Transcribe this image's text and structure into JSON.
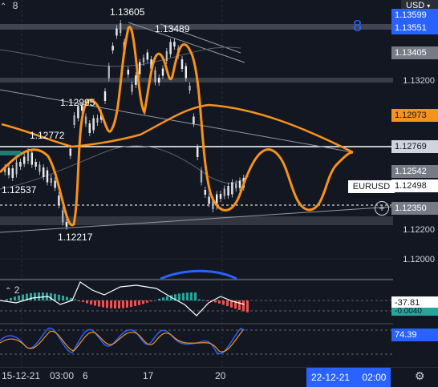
{
  "header": {
    "pane_number": "8",
    "currency": "USD"
  },
  "price_scale": {
    "ticks": [
      "1.13200",
      "1.12200",
      "1.12000"
    ],
    "tags": [
      {
        "label": "1.13599",
        "bg": "#2962ff",
        "fg": "#ffffff"
      },
      {
        "label": "1.13551",
        "bg": "#2962ff",
        "fg": "#ffffff"
      },
      {
        "label": "1.13405",
        "bg": "#787b86",
        "fg": "#ffffff"
      },
      {
        "label": "1.12973",
        "bg": "#f7931a",
        "fg": "#131722"
      },
      {
        "label": "1.12769",
        "bg": "#d1d4dc",
        "fg": "#131722"
      },
      {
        "label": "1.12542",
        "bg": "#787b86",
        "fg": "#ffffff"
      },
      {
        "label": "1.12498",
        "bg": "#ffffff",
        "fg": "#131722"
      },
      {
        "label": "1.12350",
        "bg": "#787b86",
        "fg": "#ffffff"
      }
    ]
  },
  "symbol_tag": "EURUSD",
  "annotations": [
    {
      "label": "1.13605"
    },
    {
      "label": "1.13489"
    },
    {
      "label": "1.12995"
    },
    {
      "label": "1.12772"
    },
    {
      "label": "1.12537"
    },
    {
      "label": "1.12217"
    }
  ],
  "indicators": {
    "macd_pane_number": "2",
    "macd_value": "-37.81",
    "macd_value2": "-0.0040",
    "oscillator_value": "74.39"
  },
  "time_axis": {
    "start_date": "15-12-21",
    "start_time": "03:00",
    "ticks": [
      "6",
      "17",
      "20"
    ],
    "end_date": "22-12-21",
    "end_time": "02:00"
  },
  "colors": {
    "background": "#131722",
    "orange": "#f7931a",
    "up_candle": "#ffffff",
    "macd_up": "#26a69a",
    "macd_down": "#ef5350",
    "oscillator_blue": "#2962ff"
  },
  "icons": {
    "crosshair": "plus-circle-icon",
    "settings": "gear-icon",
    "indicator_marker": "infinity-icon"
  }
}
